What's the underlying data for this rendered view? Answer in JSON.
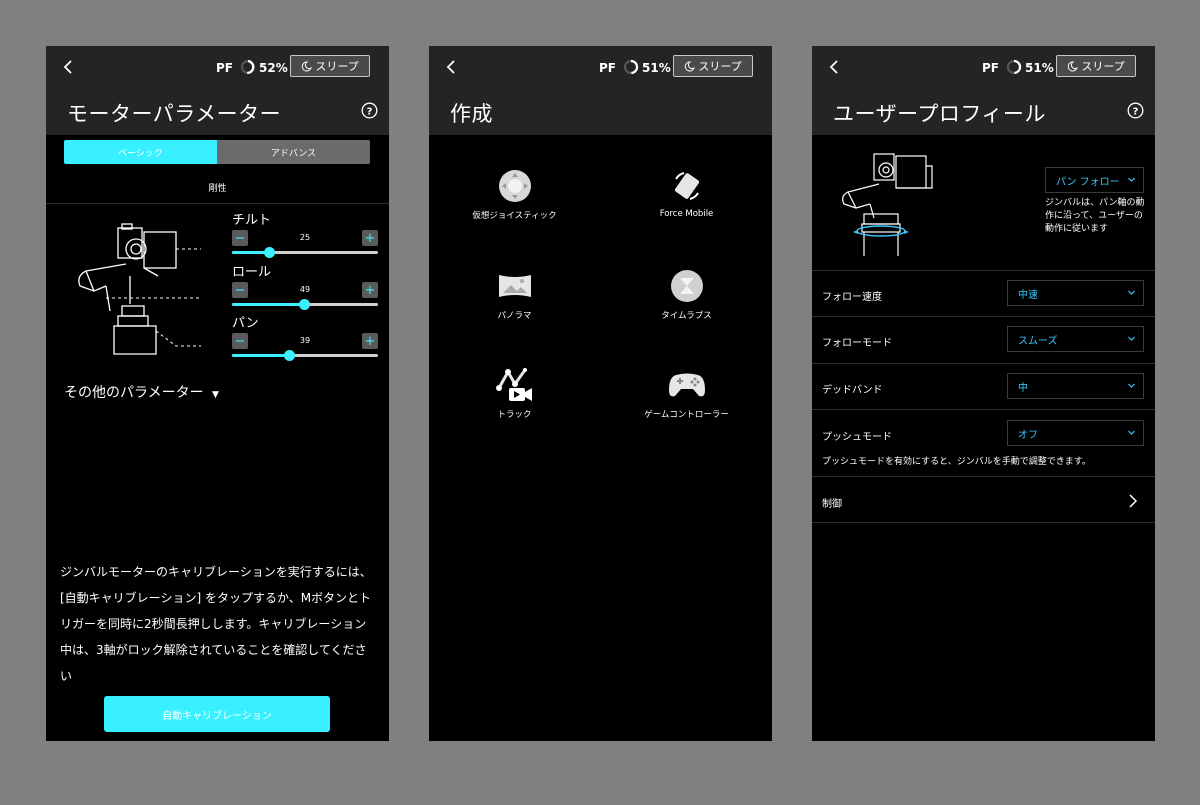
{
  "screen1": {
    "status": {
      "pf": "PF",
      "battery": "52%",
      "sleep": "スリープ"
    },
    "title": "モーターパラメーター",
    "tabs": [
      {
        "label": "ベーシック",
        "active": true
      },
      {
        "label": "アドバンス",
        "active": false
      }
    ],
    "section": "剛性",
    "axes": [
      {
        "label": "チルト",
        "value": "25",
        "fraction": 0.25
      },
      {
        "label": "ロール",
        "value": "49",
        "fraction": 0.49
      },
      {
        "label": "パン",
        "value": "39",
        "fraction": 0.39
      }
    ],
    "other_params": "その他のパラメーター",
    "calibration_text": "ジンバルモーターのキャリブレーションを実行するには、[自動キャリブレーション] をタップするか、Mボタンとトリガーを同時に2秒間長押しします。キャリブレーション中は、3軸がロック解除されていることを確認してください",
    "calibration_button": "自動キャリブレーション"
  },
  "screen2": {
    "status": {
      "pf": "PF",
      "battery": "51%",
      "sleep": "スリープ"
    },
    "title": "作成",
    "items": [
      {
        "label": "仮想ジョイスティック",
        "icon": "joystick-icon"
      },
      {
        "label": "Force Mobile",
        "icon": "force-mobile-icon"
      },
      {
        "label": "パノラマ",
        "icon": "panorama-icon"
      },
      {
        "label": "タイムラプス",
        "icon": "timelapse-icon"
      },
      {
        "label": "トラック",
        "icon": "track-icon"
      },
      {
        "label": "ゲームコントローラー",
        "icon": "gamepad-icon"
      }
    ]
  },
  "screen3": {
    "status": {
      "pf": "PF",
      "battery": "51%",
      "sleep": "スリープ"
    },
    "title": "ユーザープロフィール",
    "mode_select": "パン フォロー",
    "mode_desc": "ジンバルは、パン軸の動作に沿って、ユーザーの動作に従います",
    "rows": [
      {
        "label": "フォロー速度",
        "value": "中速"
      },
      {
        "label": "フォローモード",
        "value": "スムーズ"
      },
      {
        "label": "デッドバンド",
        "value": "中"
      },
      {
        "label": "プッシュモード",
        "value": "オフ"
      }
    ],
    "push_desc": "プッシュモードを有効にすると、ジンバルを手動で調整できます。",
    "control_label": "制御"
  },
  "colors": {
    "accent": "#38f0ff",
    "header_bg": "#242424",
    "screen_bg": "#000000",
    "page_bg": "#808080"
  }
}
